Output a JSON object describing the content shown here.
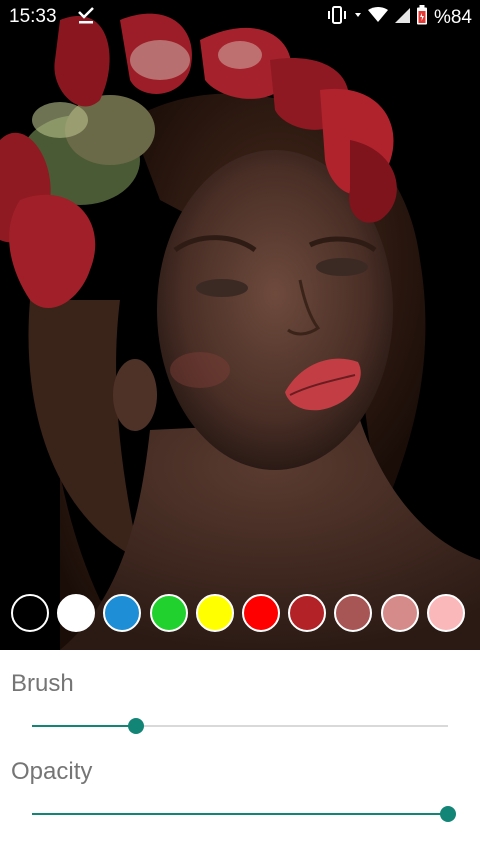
{
  "status_bar": {
    "time": "15:33",
    "battery_text": "%84",
    "icons": [
      "download-done-icon",
      "vibrate-icon",
      "data-arrows-icon",
      "wifi-icon",
      "signal-icon",
      "battery-icon"
    ]
  },
  "colors": {
    "accent": "#138577",
    "track": "#d9d9d9",
    "label": "#757575"
  },
  "palette": [
    {
      "name": "black",
      "hex": "#000000"
    },
    {
      "name": "white",
      "hex": "#ffffff"
    },
    {
      "name": "blue",
      "hex": "#1e8fd6"
    },
    {
      "name": "green",
      "hex": "#21d12e"
    },
    {
      "name": "yellow",
      "hex": "#ffff00"
    },
    {
      "name": "red",
      "hex": "#ff0000"
    },
    {
      "name": "dark-red",
      "hex": "#b32226"
    },
    {
      "name": "rose-brown",
      "hex": "#a85556"
    },
    {
      "name": "dusty-pink",
      "hex": "#d48b89"
    },
    {
      "name": "light-pink",
      "hex": "#fbb8bb"
    }
  ],
  "brush": {
    "label": "Brush",
    "value_fraction": 0.25
  },
  "opacity": {
    "label": "Opacity",
    "value_fraction": 1.0
  }
}
